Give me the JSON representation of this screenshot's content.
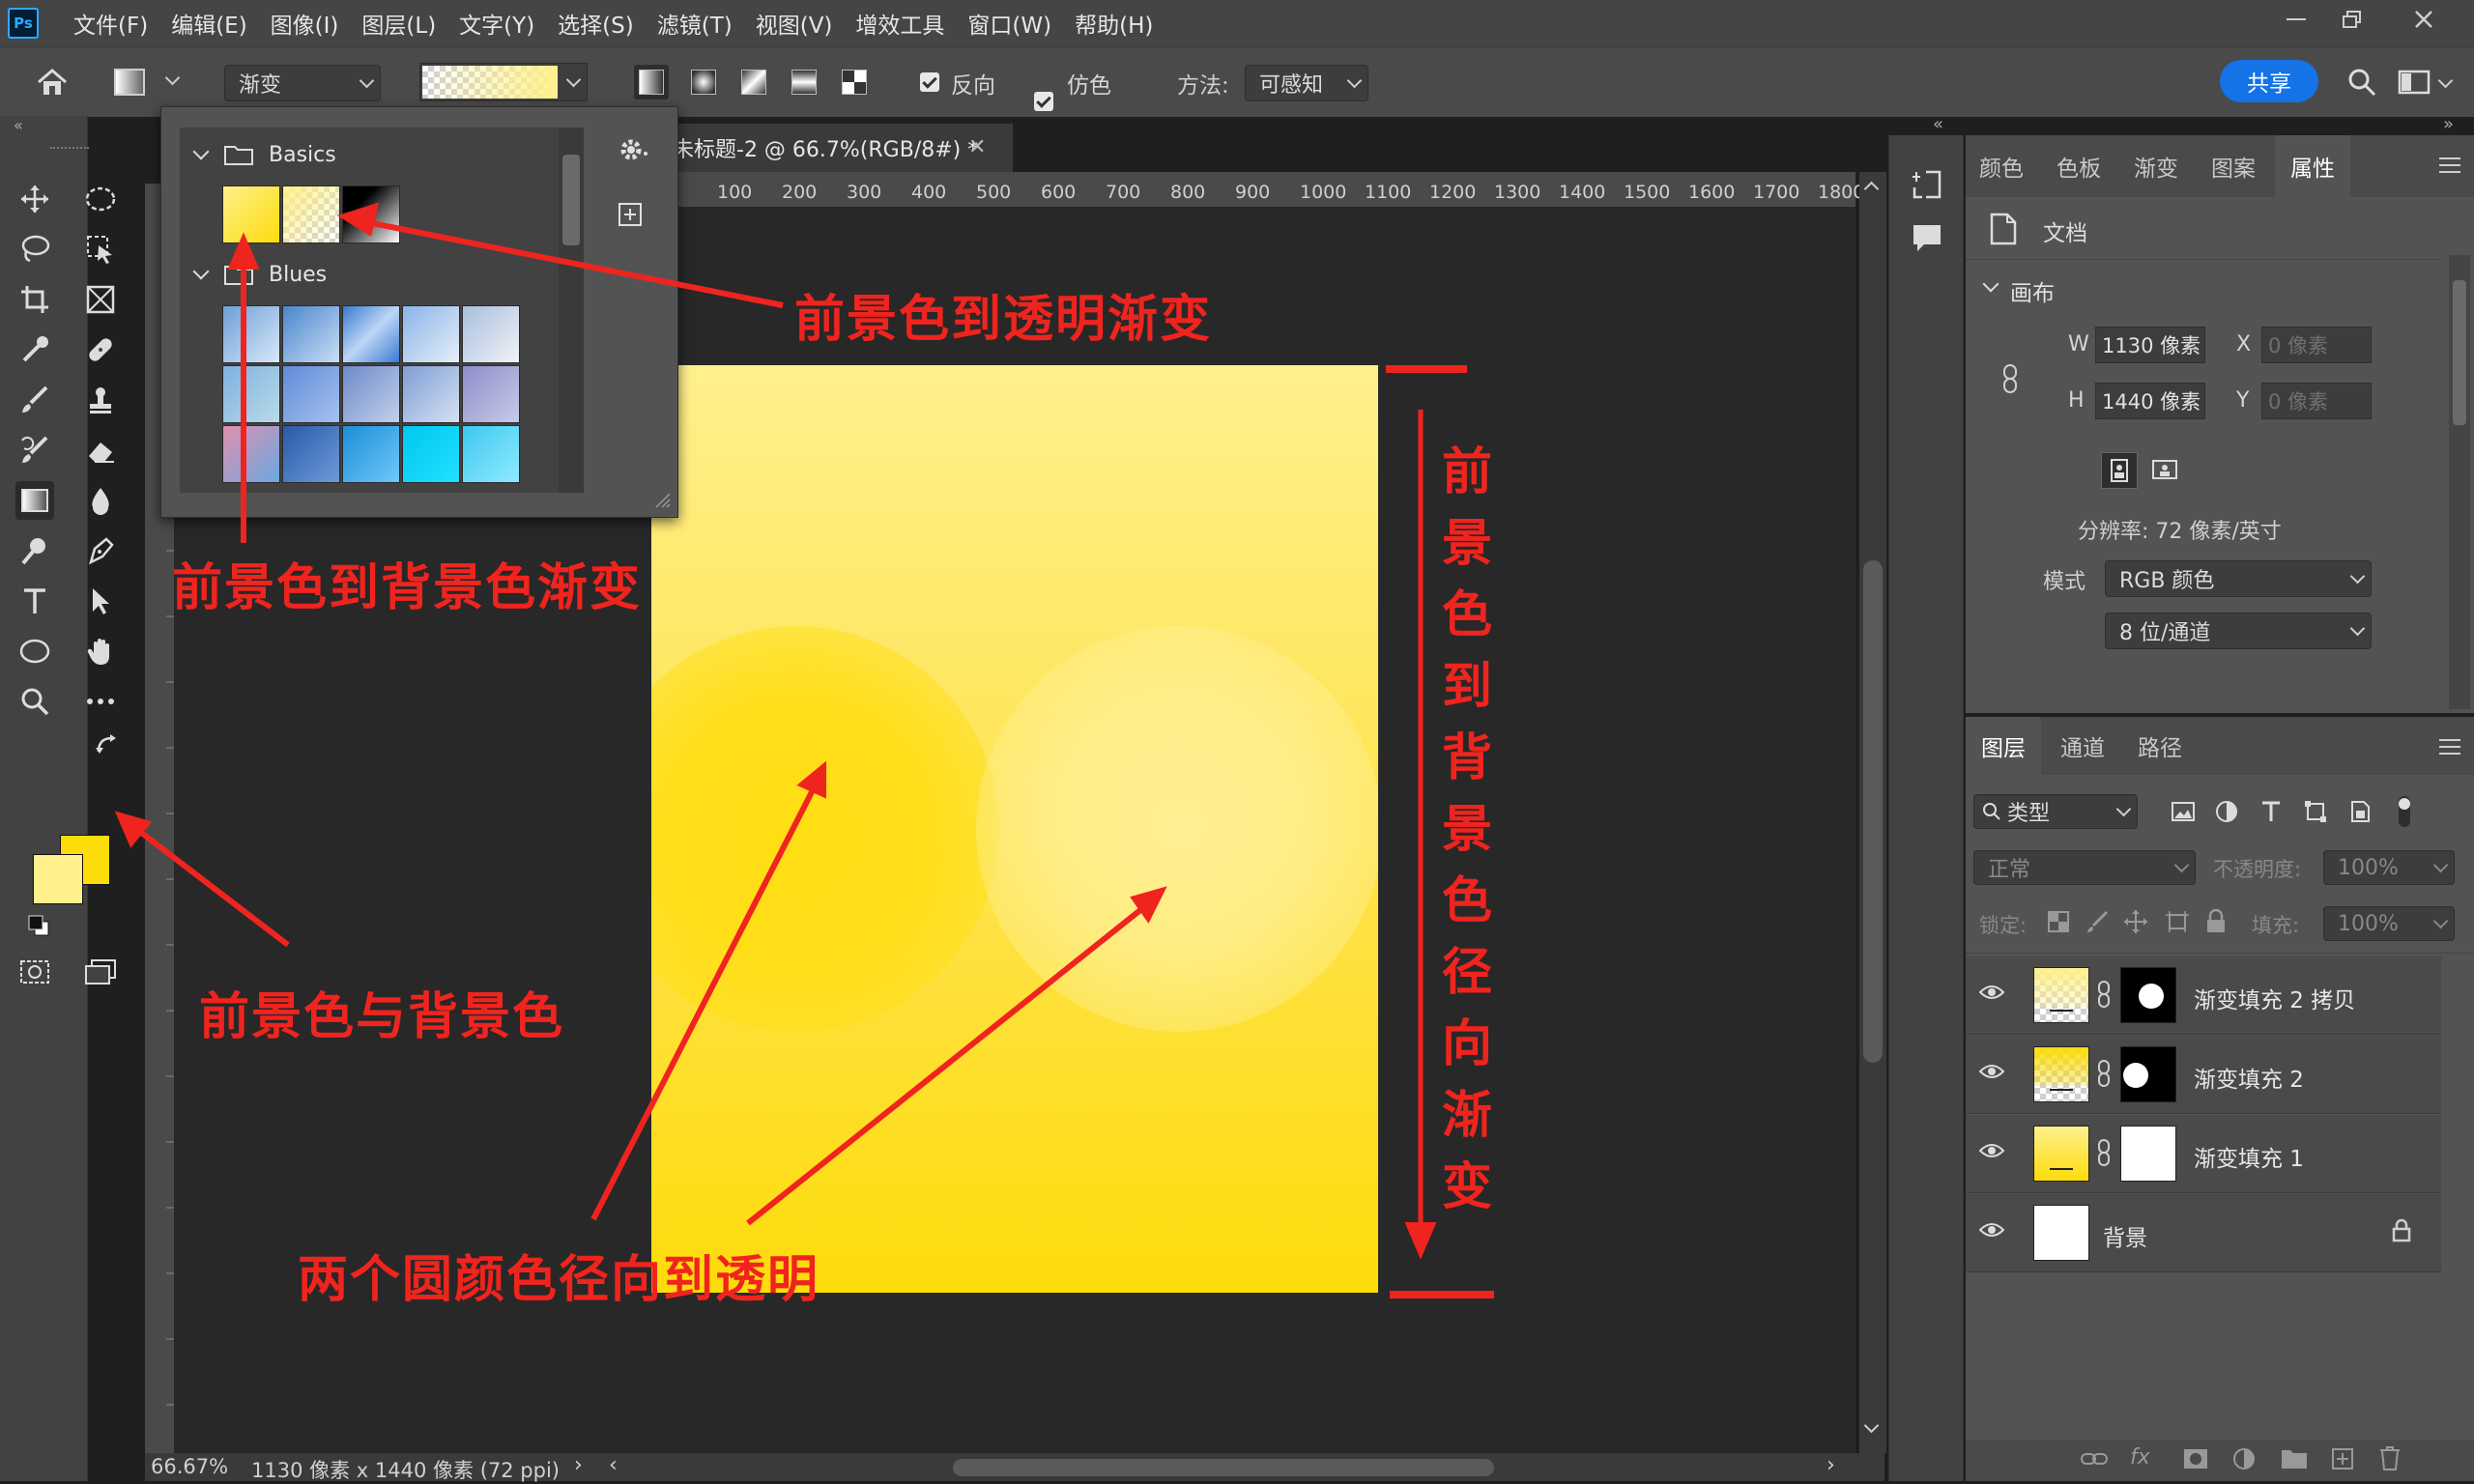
{
  "menubar": {
    "logo": "Ps",
    "items": [
      "文件(F)",
      "编辑(E)",
      "图像(I)",
      "图层(L)",
      "文字(Y)",
      "选择(S)",
      "滤镜(T)",
      "视图(V)",
      "增效工具",
      "窗口(W)",
      "帮助(H)"
    ]
  },
  "options": {
    "preset_mode": "渐变",
    "reverse_label": "反向",
    "dither_label": "仿色",
    "method_label": "方法:",
    "method_value": "可感知",
    "share_label": "共享"
  },
  "document": {
    "tab_title": "未标题-2 @ 66.7%(RGB/8#) *",
    "ruler_ticks": [
      "100",
      "200",
      "300",
      "400",
      "500",
      "600",
      "700",
      "800",
      "900",
      "1000",
      "1100",
      "1200",
      "1300",
      "1400",
      "1500",
      "1600",
      "1700",
      "1800"
    ]
  },
  "picker": {
    "folders": [
      {
        "name": "Basics"
      },
      {
        "name": "Blues"
      }
    ]
  },
  "status": {
    "zoom": "66.67%",
    "doc_info": "1130 像素 x 1440 像素 (72 ppi)"
  },
  "properties": {
    "tabs": [
      "颜色",
      "色板",
      "渐变",
      "图案",
      "属性"
    ],
    "active_tab": "属性",
    "doc_label": "文档",
    "canvas_section": "画布",
    "w_label": "W",
    "w_value": "1130 像素",
    "h_label": "H",
    "h_value": "1440 像素",
    "x_label": "X",
    "x_value": "0 像素",
    "y_label": "Y",
    "y_value": "0 像素",
    "resolution": "分辨率: 72 像素/英寸",
    "mode_label": "模式",
    "mode_value": "RGB 颜色",
    "depth_value": "8 位/通道"
  },
  "layers": {
    "tabs": [
      "图层",
      "通道",
      "路径"
    ],
    "filter_type": "类型",
    "blend_mode": "正常",
    "opacity_label": "不透明度:",
    "opacity_value": "100%",
    "lock_label": "锁定:",
    "fill_label": "填充:",
    "fill_value": "100%",
    "items": [
      {
        "name": "渐变填充 2 拷贝"
      },
      {
        "name": "渐变填充 2"
      },
      {
        "name": "渐变填充 1"
      },
      {
        "name": "背景"
      }
    ]
  },
  "annotations": {
    "fg_to_transparent": "前景色到透明渐变",
    "fg_to_bg": "前景色到背景色渐变",
    "fg_and_bg": "前景色与背景色",
    "circles": "两个圆颜色径向到透明",
    "vertical": [
      "前",
      "景",
      "色",
      "到",
      "背",
      "景",
      "色",
      "径",
      "向",
      "渐",
      "变"
    ]
  },
  "colors": {
    "foreground": "#fff08c",
    "background": "#fddc0b",
    "accent": "#1473e6",
    "annotation": "#f0241e"
  }
}
